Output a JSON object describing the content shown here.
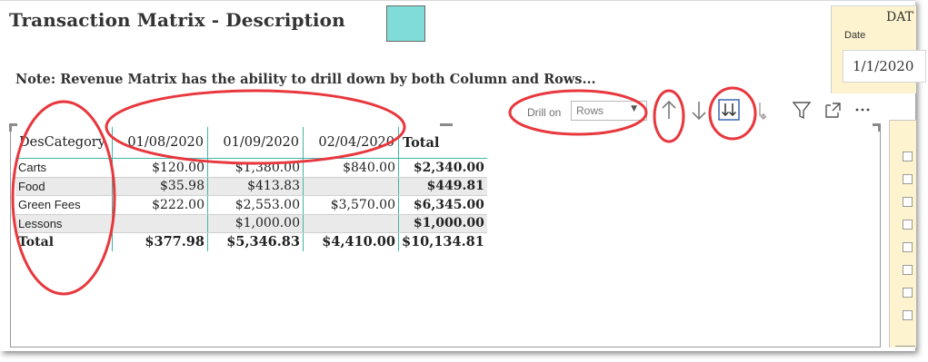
{
  "report": {
    "title": "Transaction Matrix - Description",
    "swatch_color": "#7fdcd6",
    "note": "Note: Revenue Matrix has the ability to drill down by both Column and Rows..."
  },
  "date_slicer": {
    "title": "DAT",
    "label": "Date",
    "value": "1/1/2020"
  },
  "toolbar": {
    "drill_label": "Drill on",
    "drill_value": "Rows",
    "icons": [
      "drill-up-icon",
      "drill-down-icon",
      "expand-all-down-icon",
      "expand-next-level-icon",
      "filter-icon",
      "focus-mode-icon",
      "more-options-icon"
    ]
  },
  "matrix": {
    "headers": [
      "DesCategory",
      "01/08/2020",
      "01/09/2020",
      "02/04/2020",
      "Total"
    ],
    "rows": [
      {
        "category": "Carts",
        "values": [
          "$120.00",
          "$1,380.00",
          "$840.00"
        ],
        "total": "$2,340.00"
      },
      {
        "category": "Food",
        "values": [
          "$35.98",
          "$413.83",
          ""
        ],
        "total": "$449.81"
      },
      {
        "category": "Green Fees",
        "values": [
          "$222.00",
          "$2,553.00",
          "$3,570.00"
        ],
        "total": "$6,345.00"
      },
      {
        "category": "Lessons",
        "values": [
          "",
          "$1,000.00",
          ""
        ],
        "total": "$1,000.00"
      }
    ],
    "grand_total": {
      "category": "Total",
      "values": [
        "$377.98",
        "$5,346.83",
        "$4,410.00"
      ],
      "total": "$10,134.81"
    },
    "accent_color": "#3fb5a8"
  },
  "annotation_color": "#e8373d"
}
